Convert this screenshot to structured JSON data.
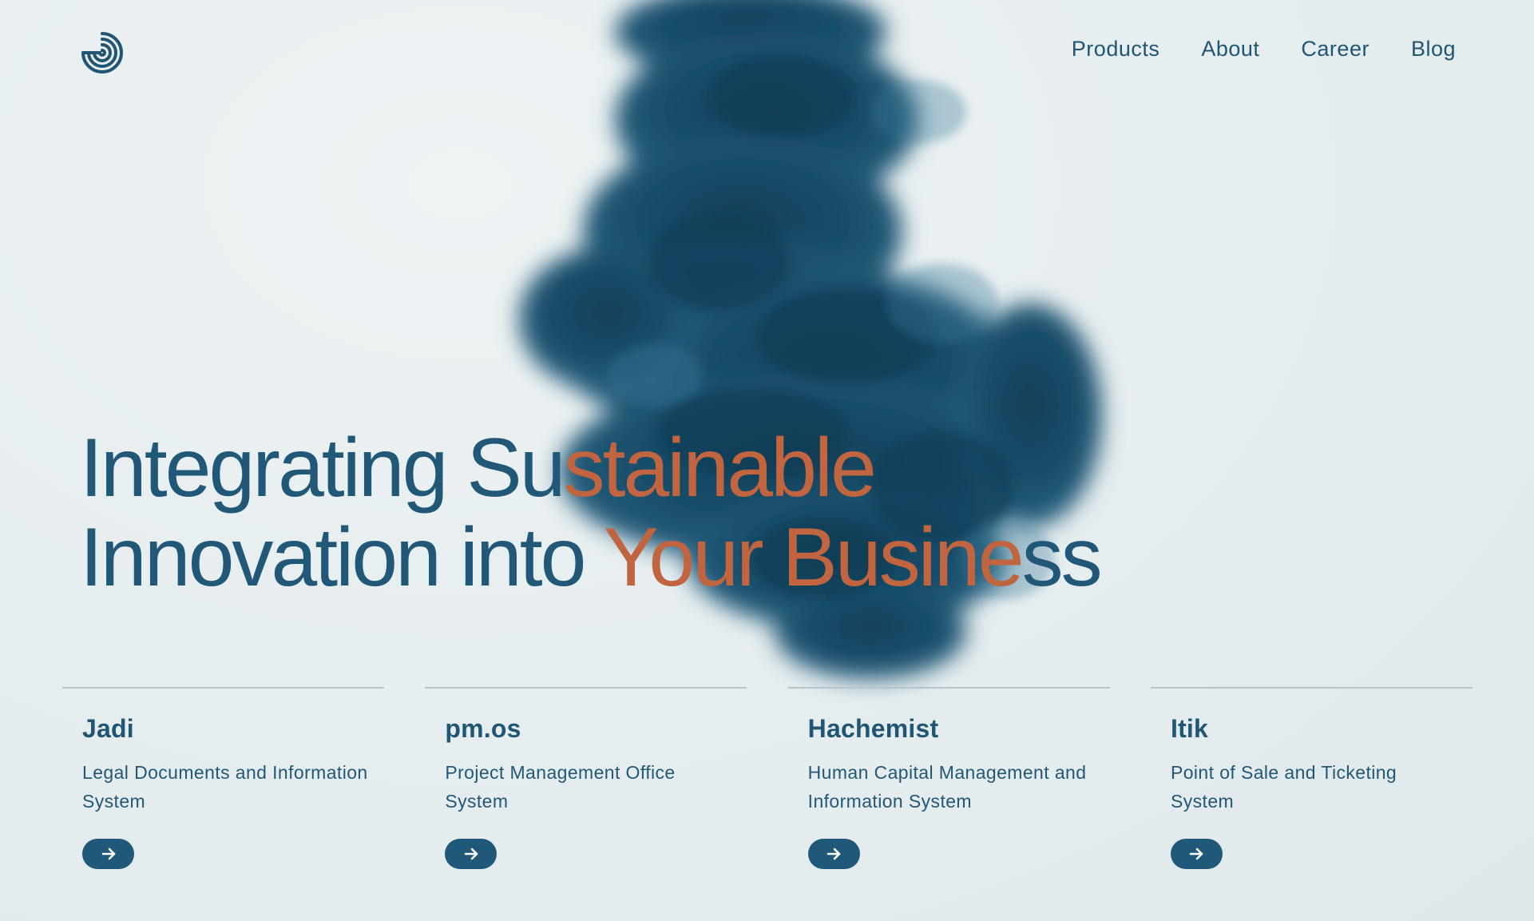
{
  "brand": {
    "logo_icon": "concentric-swirl-logo",
    "accent_color": "#205674",
    "highlight_color": "#c0653f"
  },
  "nav": {
    "items": [
      {
        "label": "Products"
      },
      {
        "label": "About"
      },
      {
        "label": "Career"
      },
      {
        "label": "Blog"
      }
    ]
  },
  "hero": {
    "line1_part1": "Integrating Su",
    "line1_part2": "stainable",
    "line2_part1": "Innovation into ",
    "line2_part2": "Your Busine",
    "line2_part3": "ss"
  },
  "products": [
    {
      "name": "Jadi",
      "description": "Legal Documents and Information System",
      "action_icon": "arrow-right-icon"
    },
    {
      "name": "pm.os",
      "description": "Project Management Office System",
      "action_icon": "arrow-right-icon"
    },
    {
      "name": "Hachemist",
      "description": "Human Capital Management and Information System",
      "action_icon": "arrow-right-icon"
    },
    {
      "name": "Itik",
      "description": "Point of Sale and Ticketing System",
      "action_icon": "arrow-right-icon"
    }
  ]
}
